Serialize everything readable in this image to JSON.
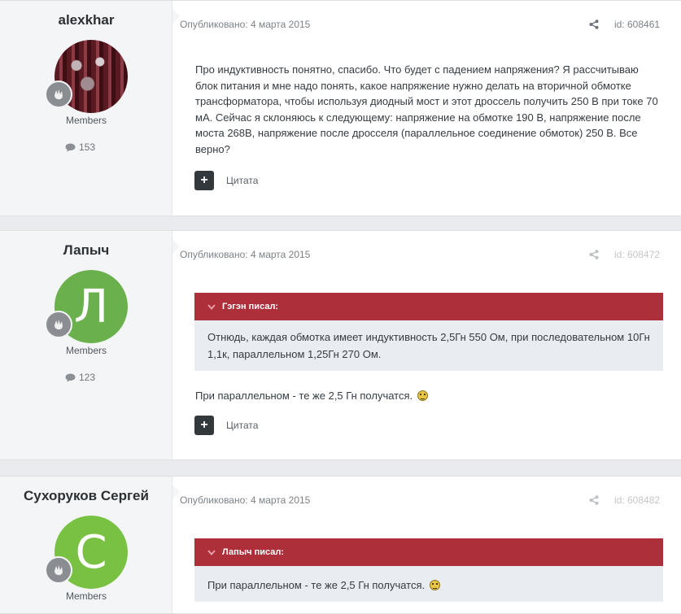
{
  "posts": [
    {
      "author": "alexkhar",
      "group": "Members",
      "post_count": "153",
      "published": "Опубликовано: 4 марта 2015",
      "post_id": "id: 608461",
      "body": "Про индуктивность понятно, спасибо. Что будет с падением напряжения? Я рассчитываю блок питания и мне надо понять, какое напряжение нужно делать на вторичной обмотке трансформатора, чтобы используя диодный мост и этот дроссель получить 250 В при токе 70 мА. Сейчас я склоняюсь к следующему: напряжение на обмотке 190 В, напряжение после моста 268В, напряжение после дросселя (параллельное соединение обмоток) 250 В. Все верно?",
      "quote_label": "Цитата"
    },
    {
      "author": "Лапыч",
      "avatar_letter": "Л",
      "avatar_color": "#6ab04c",
      "group": "Members",
      "post_count": "123",
      "published": "Опубликовано: 4 марта 2015",
      "post_id": "id: 608472",
      "quote_author": "Гэгэн писал:",
      "quote_text": "Отнюдь, каждая обмотка имеет индуктивность 2,5Гн 550 Ом, при последовательном 10Гн 1,1к, параллельном 1,25Гн 270 Ом.",
      "body": "При параллельном - те же 2,5 Гн получатся.",
      "quote_label": "Цитата"
    },
    {
      "author": "Сухоруков Сергей",
      "avatar_letter": "С",
      "avatar_color": "#79c142",
      "group": "Members",
      "published": "Опубликовано: 4 марта 2015",
      "post_id": "id: 608482",
      "quote_author": "Лапыч писал:",
      "quote_text": "При параллельном - те же 2,5 Гн получатся."
    }
  ],
  "colors": {
    "quote_header": "#ad2f3a",
    "quote_body": "#e9ecf0",
    "author_panel": "#f4f5f6"
  }
}
